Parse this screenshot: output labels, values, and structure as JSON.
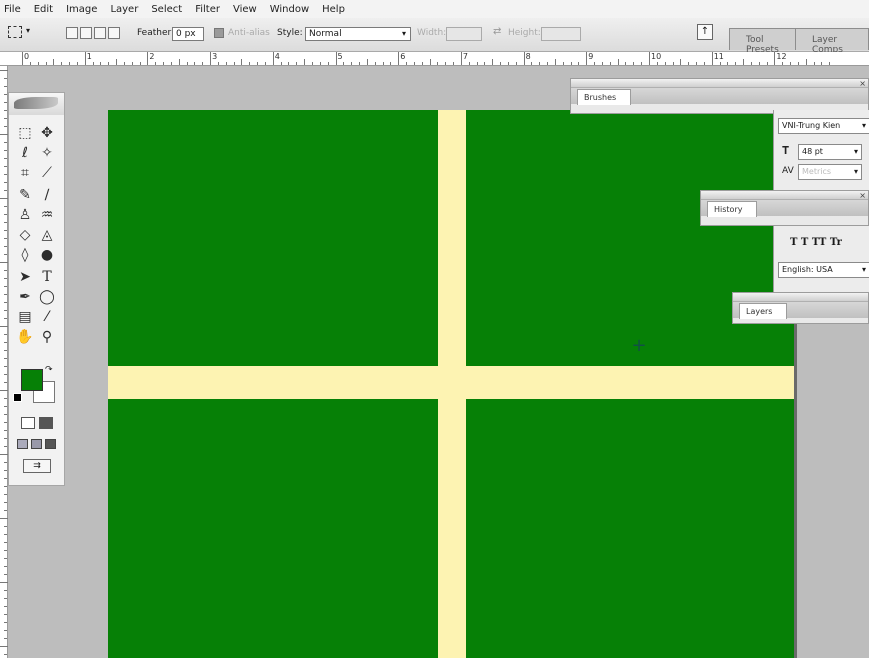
{
  "menu": [
    "File",
    "Edit",
    "Image",
    "Layer",
    "Select",
    "Filter",
    "View",
    "Window",
    "Help"
  ],
  "options": {
    "feather_label": "Feather:",
    "feather_value": "0 px",
    "antialias_label": "Anti-alias",
    "style_label": "Style:",
    "style_value": "Normal",
    "width_label": "Width:",
    "height_label": "Height:"
  },
  "wells": [
    "Tool Presets",
    "Layer Comps"
  ],
  "ruler": [
    "0",
    "1",
    "2",
    "3",
    "4",
    "5",
    "6",
    "7",
    "8",
    "9",
    "10",
    "11",
    "12"
  ],
  "palettes": {
    "brushes": "Brushes",
    "history": "History",
    "layers": "Layers"
  },
  "character": {
    "font_family": "VNI-Trung Kien",
    "font_size": "48 pt",
    "tracking": "Metrics",
    "style_buttons": "T  T  TT  Tr",
    "language": "English: USA"
  },
  "colors": {
    "canvas": "#068006",
    "cross": "#fdf3b2",
    "foreground": "#068006",
    "background": "#ffffff"
  }
}
